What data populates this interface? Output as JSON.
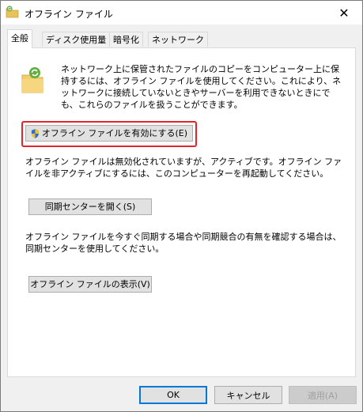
{
  "window": {
    "title": "オフライン ファイル",
    "close_glyph": "✕"
  },
  "tabs": [
    {
      "label": "全般",
      "active": true
    },
    {
      "label": "ディスク使用量",
      "active": false
    },
    {
      "label": "暗号化",
      "active": false
    },
    {
      "label": "ネットワーク",
      "active": false
    }
  ],
  "general": {
    "intro_text": "ネットワーク上に保管されたファイルのコピーをコンピューター上に保持するには、オフライン ファイルを使用してください。これにより、ネットワークに接続していないときやサーバーを利用できないときにでも、これらのファイルを扱うことができます。",
    "enable_button": "オフライン ファイルを有効にする(E)",
    "status_text": "オフライン ファイルは無効化されていますが、アクティブです。オフライン ファイルを非アクティブにするには、このコンピューターを再起動してください。",
    "sync_center_button": "同期センターを開く(S)",
    "sync_text": "オフライン ファイルを今すぐ同期する場合や同期競合の有無を確認する場合は、同期センターを使用してください。",
    "view_files_button": "オフライン ファイルの表示(V)"
  },
  "footer": {
    "ok": "OK",
    "cancel": "キャンセル",
    "apply": "適用(A)"
  },
  "colors": {
    "highlight": "#e3242b",
    "default_border": "#0078d7"
  }
}
